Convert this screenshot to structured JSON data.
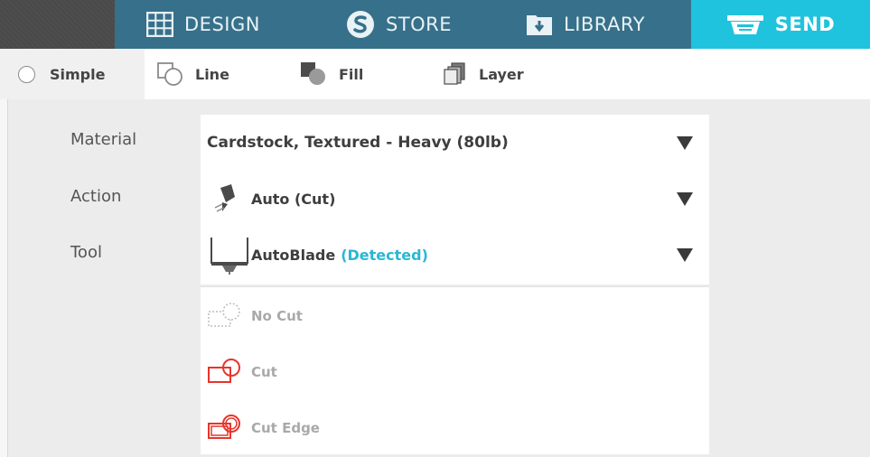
{
  "nav": {
    "tabs": [
      {
        "label": "DESIGN",
        "icon": "grid-icon"
      },
      {
        "label": "STORE",
        "icon": "store-s-icon"
      },
      {
        "label": "LIBRARY",
        "icon": "download-folder-icon"
      },
      {
        "label": "SEND",
        "icon": "cutting-machine-icon",
        "active": true
      }
    ]
  },
  "modes": {
    "simple": "Simple",
    "line": "Line",
    "fill": "Fill",
    "layer": "Layer"
  },
  "settings": {
    "material_label": "Material",
    "action_label": "Action",
    "tool_label": "Tool",
    "material_value": "Cardstock, Textured - Heavy (80lb)",
    "action_value": "Auto (Cut)",
    "tool_value": "AutoBlade",
    "tool_status": "(Detected)"
  },
  "cut_options": [
    "No Cut",
    "Cut",
    "Cut Edge"
  ],
  "colors": {
    "nav_bar": "#37708a",
    "active_tab": "#20c3dd",
    "detected_text": "#29b7d4",
    "cut_icon_red": "#e8352b"
  }
}
